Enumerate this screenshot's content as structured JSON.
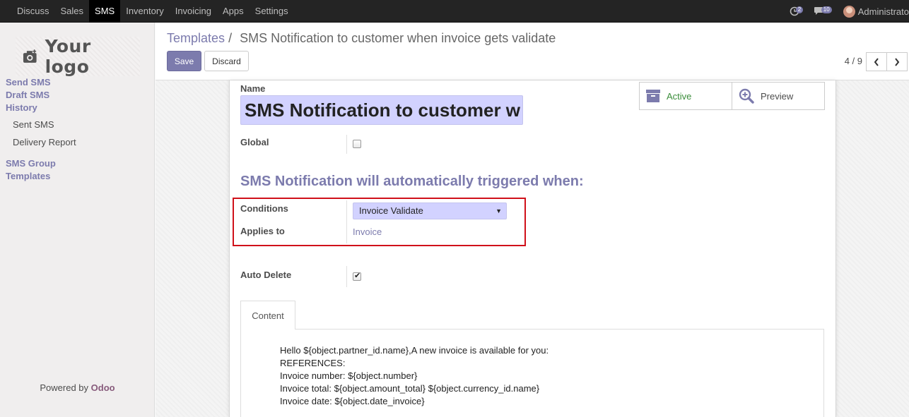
{
  "topbar": {
    "menu": [
      "Discuss",
      "Sales",
      "SMS",
      "Inventory",
      "Invoicing",
      "Apps",
      "Settings"
    ],
    "active_menu": "SMS",
    "activity_badge": "2",
    "messages_badge": "10",
    "user_name": "Administrato"
  },
  "sidebar": {
    "logo_text": "Your logo",
    "sections": [
      "Send SMS",
      "Draft SMS",
      "History",
      "SMS Group",
      "Templates"
    ],
    "history_items": [
      "Sent SMS",
      "Delivery Report"
    ],
    "powered_by_prefix": "Powered by",
    "powered_by_brand": "Odoo"
  },
  "control_panel": {
    "breadcrumb_parent": "Templates",
    "breadcrumb_separator": "/",
    "breadcrumb_current": "SMS Notification to customer when invoice gets validate",
    "save_label": "Save",
    "discard_label": "Discard",
    "pager": "4 / 9"
  },
  "form": {
    "name_label": "Name",
    "name_value": "SMS Notification to customer w",
    "active_label": "Active",
    "preview_label": "Preview",
    "global_label": "Global",
    "global_checked": false,
    "section_title": "SMS Notification will automatically triggered when:",
    "conditions_label": "Conditions",
    "conditions_value": "Invoice Validate",
    "applies_to_label": "Applies to",
    "applies_to_value": "Invoice",
    "auto_delete_label": "Auto Delete",
    "auto_delete_checked": true,
    "tab_label": "Content",
    "content_lines": [
      "Hello ${object.partner_id.name},A new invoice is available for you:",
      "REFERENCES:",
      "Invoice number: ${object.number}",
      "Invoice total: ${object.amount_total} ${object.currency_id.name}",
      "Invoice date: ${object.date_invoice}"
    ]
  },
  "colors": {
    "accent": "#7c7bad",
    "brand": "#875a7b",
    "active_green": "#3b8d3b",
    "highlight_box": "#d0101a",
    "input_bg": "#d2d2ff"
  }
}
